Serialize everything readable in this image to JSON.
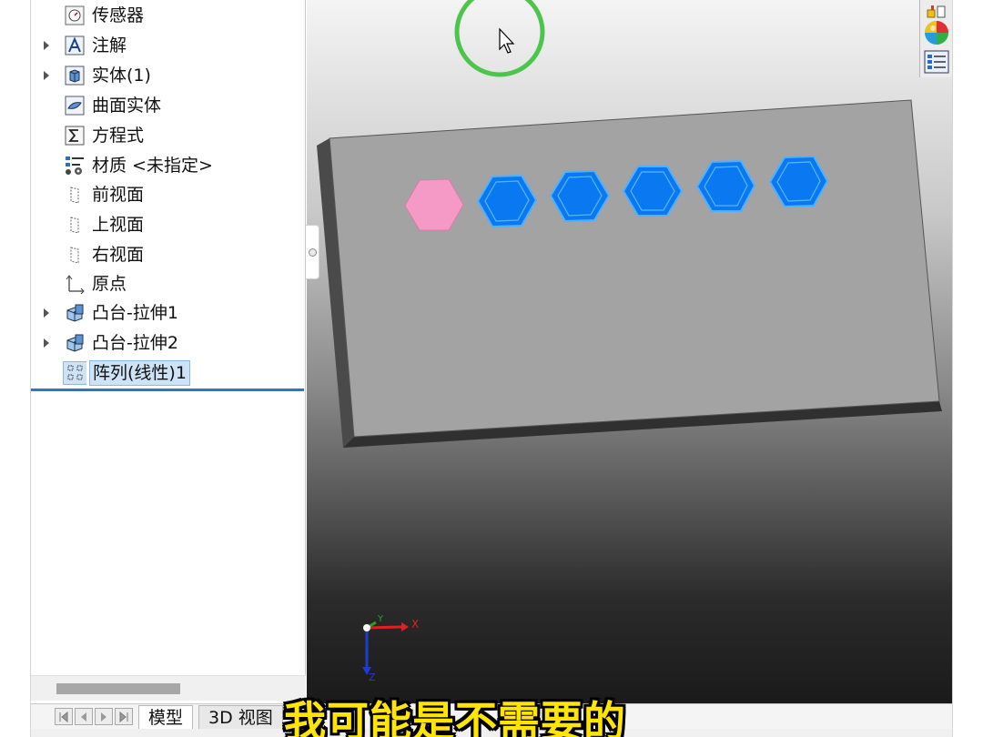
{
  "feature_tree": {
    "items": [
      {
        "label": "传感器",
        "icon": "sensor-icon",
        "expandable": false
      },
      {
        "label": "注解",
        "icon": "annotation-icon",
        "expandable": true
      },
      {
        "label": "实体(1)",
        "icon": "solid-body-icon",
        "expandable": true
      },
      {
        "label": "曲面实体",
        "icon": "surface-body-icon",
        "expandable": false
      },
      {
        "label": "方程式",
        "icon": "equation-icon",
        "expandable": false
      },
      {
        "label": "材质 <未指定>",
        "icon": "material-icon",
        "expandable": false
      },
      {
        "label": "前视面",
        "icon": "plane-icon",
        "expandable": false
      },
      {
        "label": "上视面",
        "icon": "plane-icon",
        "expandable": false
      },
      {
        "label": "右视面",
        "icon": "plane-icon",
        "expandable": false
      },
      {
        "label": "原点",
        "icon": "origin-icon",
        "expandable": false
      },
      {
        "label": "凸台-拉伸1",
        "icon": "boss-extrude-icon",
        "expandable": true
      },
      {
        "label": "凸台-拉伸2",
        "icon": "boss-extrude-icon",
        "expandable": true
      },
      {
        "label": "阵列(线性)1",
        "icon": "linear-pattern-icon",
        "expandable": false,
        "selected": true
      }
    ]
  },
  "tabs": {
    "model": "模型",
    "view3d": "3D 视图"
  },
  "viewport": {
    "triad": {
      "x_label": "X",
      "y_label": "Y",
      "z_label": "Z"
    },
    "colors": {
      "plate_top": "#a3a3a3",
      "seed_hexagon": "#f59ac6",
      "pattern_hexagon": "#0a78f0",
      "selection_ring": "#4cc64a"
    },
    "hexagons": {
      "seed_count": 1,
      "pattern_count": 5
    }
  },
  "task_pane": {
    "icons": [
      "design-library-icon",
      "appearances-icon",
      "custom-properties-icon"
    ]
  },
  "subtitle": "我可能是不需要的"
}
